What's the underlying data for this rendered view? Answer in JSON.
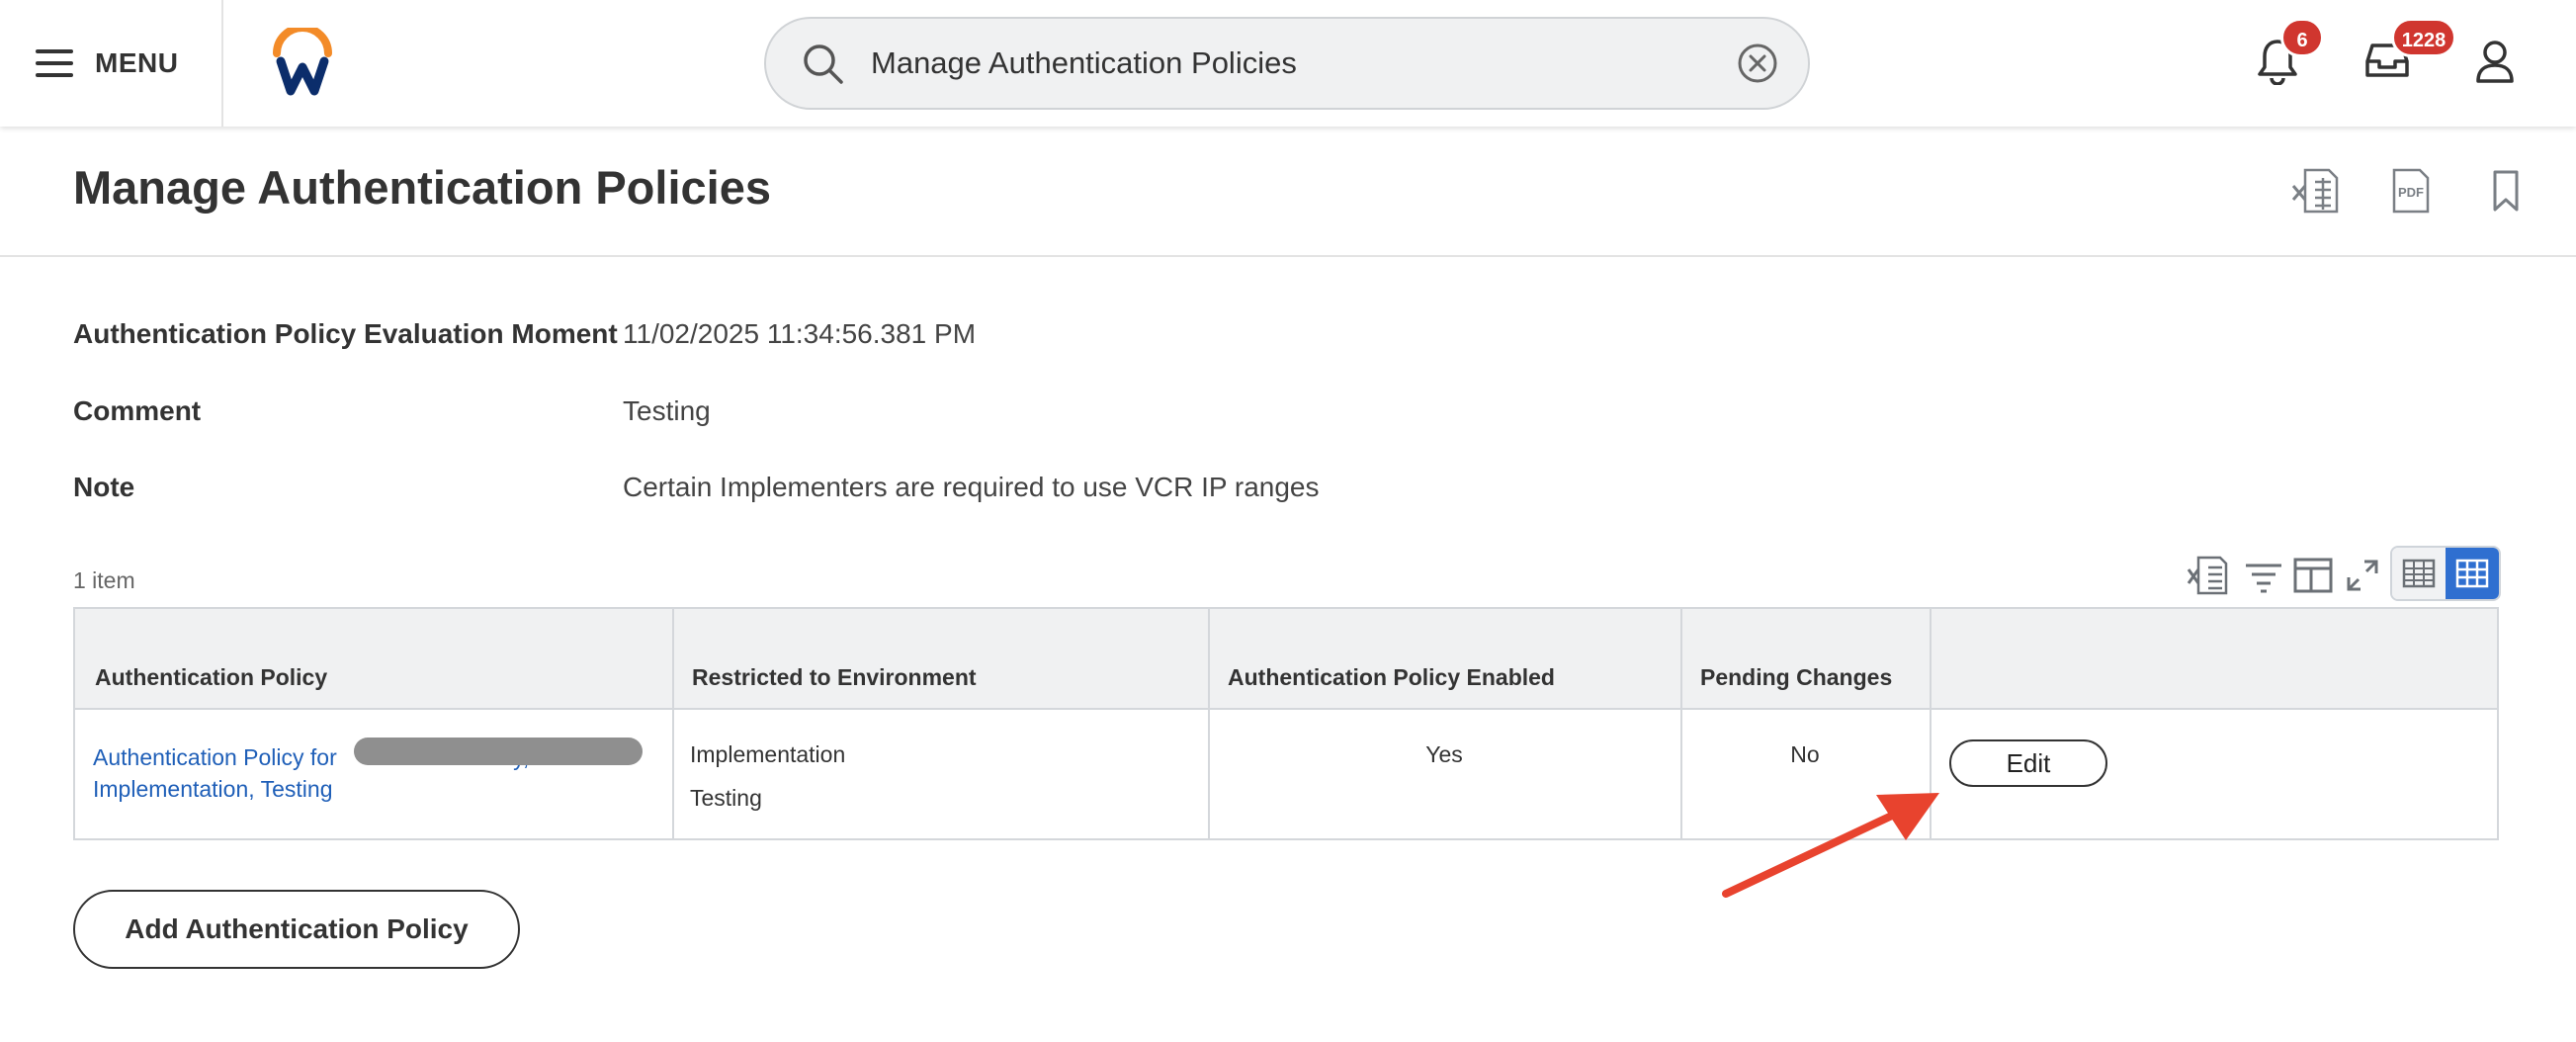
{
  "topbar": {
    "menu_label": "MENU",
    "search_value": "Manage Authentication Policies",
    "notifications_count": "6",
    "inbox_count": "1228"
  },
  "page": {
    "title": "Manage Authentication Policies"
  },
  "fields": [
    {
      "label": "Authentication Policy Evaluation Moment",
      "value": "11/02/2025 11:34:56.381 PM"
    },
    {
      "label": "Comment",
      "value": "Testing"
    },
    {
      "label": "Note",
      "value": "Certain Implementers are required to use VCR IP ranges"
    }
  ],
  "table": {
    "item_count": "1 item",
    "columns": [
      "Authentication Policy",
      "Restricted to Environment",
      "Authentication Policy Enabled",
      "Pending Changes",
      ""
    ],
    "rows": [
      {
        "policy_line1": "Authentication Policy for",
        "policy_line1_tail": "y,",
        "policy_line2": "Implementation, Testing",
        "environments": [
          "Implementation",
          "Testing"
        ],
        "enabled": "Yes",
        "pending": "No",
        "action_label": "Edit"
      }
    ]
  },
  "actions": {
    "add_policy_label": "Add Authentication Policy"
  },
  "colors": {
    "accent_blue": "#2f6fd0",
    "link_blue": "#1f5fb8",
    "badge_red": "#d0362f",
    "annotation_arrow": "#e8432e",
    "logo_orange": "#f38b28",
    "logo_navy": "#0b2d6b"
  },
  "icons": {
    "menu": "hamburger-icon",
    "search": "search-icon",
    "clear": "clear-circle-x-icon",
    "notifications": "bell-icon",
    "inbox": "inbox-tray-icon",
    "profile": "user-icon",
    "export_excel": "excel-export-icon",
    "export_pdf": "pdf-export-icon",
    "bookmark": "bookmark-icon"
  }
}
